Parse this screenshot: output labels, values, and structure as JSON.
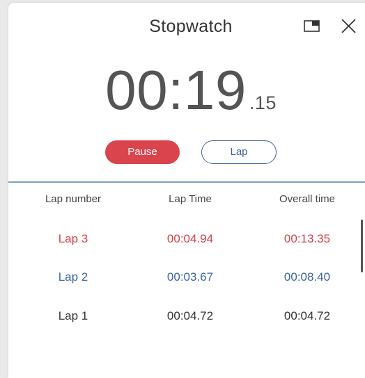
{
  "window": {
    "title": "Stopwatch"
  },
  "timer": {
    "main": "00:19",
    "fraction": ".15"
  },
  "controls": {
    "pause_label": "Pause",
    "lap_label": "Lap"
  },
  "table": {
    "headers": [
      "Lap number",
      "Lap Time",
      "Overall time"
    ],
    "rows": [
      {
        "lap": "Lap 3",
        "lap_time": "00:04.94",
        "overall": "00:13.35",
        "color": "#d63f48"
      },
      {
        "lap": "Lap 2",
        "lap_time": "00:03.67",
        "overall": "00:08.40",
        "color": "#3a64a6"
      },
      {
        "lap": "Lap 1",
        "lap_time": "00:04.72",
        "overall": "00:04.72",
        "color": "#333333"
      }
    ]
  },
  "colors": {
    "accent_red": "#d9444d",
    "accent_blue": "#3a64a6",
    "divider": "#7fa0b8"
  },
  "icons": {
    "compact": "compact-overlay-icon",
    "close": "close-icon"
  }
}
